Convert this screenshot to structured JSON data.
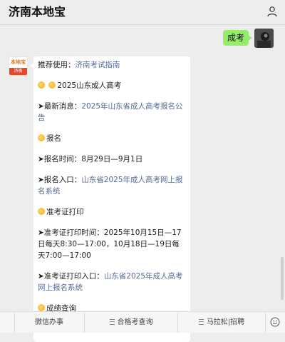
{
  "header": {
    "title": "济南本地宝"
  },
  "outgoing": {
    "text": "成考"
  },
  "incoming": {
    "avatar": {
      "top": "本地宝",
      "bottom": "济南"
    },
    "recommend_label": "推荐使用：",
    "recommend_link": "济南考试指南",
    "heading": "2025山东成人高考",
    "news_label": "➤最新消息：",
    "news_link": "2025年山东省成人高考报名公告",
    "signup_heading": "报名",
    "signup_time": "➤报名时间：8月29日—9月1日",
    "signup_entry_label": "➤报名入口：",
    "signup_entry_link": "山东省2025年成人高考网上报名系统",
    "admit_heading": "准考证打印",
    "admit_time": "➤准考证打印时间：2025年10月15日—17日每天8:30—17:00，10月18日—19日每天7:00—17:00",
    "admit_entry_label": "➤准考证打印入口：",
    "admit_entry_link": "山东省2025年成人高考网上报名系统",
    "score_heading": "成绩查询"
  },
  "bottom_menu": {
    "items": [
      "微信办事",
      "合格考查询",
      "马拉松|招聘"
    ]
  }
}
